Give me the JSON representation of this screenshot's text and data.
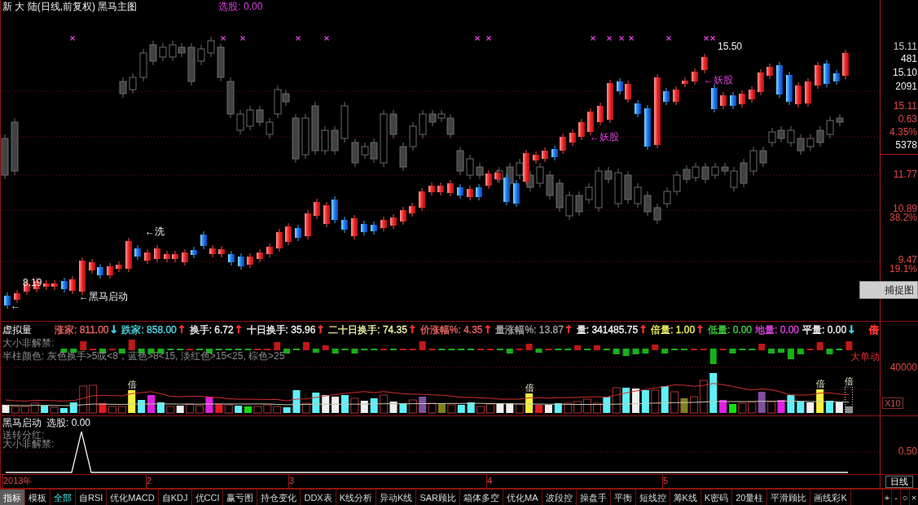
{
  "main_chart": {
    "title": "新 大 陆(日线,前复权) 黑马主图",
    "signal_readout": "选股: 0.00",
    "annotations": [
      {
        "text": "8.19",
        "kind": "note"
      },
      {
        "text": "←",
        "kind": "note"
      },
      {
        "text": "←黑马启动",
        "kind": "note"
      },
      {
        "text": "←洗",
        "kind": "note"
      },
      {
        "text": "←妖股",
        "kind": "alert"
      },
      {
        "text": "←妖股",
        "kind": "alert"
      },
      {
        "text": "15.50",
        "kind": "note"
      }
    ],
    "quote_box": [
      {
        "text": "15.11",
        "color": "#c8c8c8"
      },
      {
        "text": "481",
        "color": "#f0f0f0"
      },
      {
        "text": "15.10",
        "color": "#f0f0f0"
      },
      {
        "text": "2091",
        "color": "#f0f0f0"
      },
      {
        "text": "15.11",
        "color": "#e04848"
      },
      {
        "text": "0.63",
        "color": "#e04848"
      },
      {
        "text": "4.35%",
        "color": "#e04848"
      },
      {
        "text": "5378",
        "color": "#f0f0f0"
      }
    ],
    "axis_ticks": [
      "11.77",
      "10.89",
      "38.2%",
      "9.47",
      "19.1%"
    ],
    "capture_button": "捕捉图"
  },
  "volume_panel": {
    "title": "虚拟量",
    "readouts": [
      {
        "text": "涨家: 811.00",
        "color": "#e86464",
        "arrow": {
          "text": "↓",
          "color": "#40d8f0"
        }
      },
      {
        "text": "跌家: 858.00",
        "color": "#50d8e8",
        "arrow": {
          "text": "↑",
          "color": "#ff3030"
        }
      },
      {
        "text": "换手: 6.72",
        "color": "#f0f0f0",
        "arrow": {
          "text": "↑",
          "color": "#ff3030"
        }
      },
      {
        "text": "十日换手: 35.96",
        "color": "#f0f0f0",
        "arrow": {
          "text": "↑",
          "color": "#ff3030"
        }
      },
      {
        "text": "二十日换手: 74.35",
        "color": "#f0f0a0",
        "arrow": {
          "text": "↑",
          "color": "#ff3030"
        }
      },
      {
        "text": "价涨幅%: 4.35",
        "color": "#e86464",
        "arrow": {
          "text": "↑",
          "color": "#ff3030"
        }
      },
      {
        "text": "量涨幅%: 13.87",
        "color": "#a0a0a0",
        "arrow": {
          "text": "↑",
          "color": "#ff3030"
        }
      },
      {
        "text": "量: 341485.75",
        "color": "#f0f0f0",
        "arrow": {
          "text": "↑",
          "color": "#ff3030"
        }
      },
      {
        "text": "倍量: 1.00",
        "color": "#f0f060",
        "arrow": {
          "text": "↑",
          "color": "#ff3030"
        }
      },
      {
        "text": "低量: 0.00",
        "color": "#40d040"
      },
      {
        "text": "地量: 0.00",
        "color": "#e040e0"
      },
      {
        "text": "平量: 0.00",
        "color": "#f0f0f0",
        "arrow": {
          "text": "↓",
          "color": "#40d8f0"
        }
      },
      {
        "text": "倍",
        "color": "#ff3030"
      }
    ],
    "notes": [
      "大小非解禁:",
      "半柱颜色: 灰色换手>5或<8，蓝色>8<15, 淡红色>15<25, 棕色>25"
    ],
    "side_label": "大单动",
    "bar_marks": [
      "倍",
      "倍",
      "倍",
      "倍"
    ],
    "axis_ticks": [
      "40000"
    ],
    "scale_badge": "X10"
  },
  "signal_panel": {
    "title": "黑马启动",
    "readout": "选股: 0.00",
    "notes": [
      "送转分红:",
      "大小非解禁:"
    ],
    "axis_ticks": [
      "0.50"
    ]
  },
  "date_axis": {
    "labels": [
      "2013年",
      "2",
      "3",
      "4",
      "5"
    ],
    "period": "日线"
  },
  "bottom_bar": {
    "mode_tabs": [
      {
        "label": "指标",
        "selected": true
      },
      {
        "label": "模板",
        "selected": false
      }
    ],
    "indicator_tabs": [
      {
        "label": "全部",
        "selected": true
      },
      {
        "label": "自RSI",
        "selected": false
      },
      {
        "label": "优化MACD",
        "selected": false
      },
      {
        "label": "自KDJ",
        "selected": false
      },
      {
        "label": "优CCI",
        "selected": false
      },
      {
        "label": "赢亏图",
        "selected": false
      },
      {
        "label": "持仓变化",
        "selected": false
      },
      {
        "label": "DDX表",
        "selected": false
      },
      {
        "label": "K线分析",
        "selected": false
      },
      {
        "label": "异动K线",
        "selected": false
      },
      {
        "label": "SAR顾比",
        "selected": false
      },
      {
        "label": "箱体多空",
        "selected": false
      },
      {
        "label": "优化MA",
        "selected": false
      },
      {
        "label": "波段控",
        "selected": false
      },
      {
        "label": "操盘手",
        "selected": false
      },
      {
        "label": "平衡",
        "selected": false
      },
      {
        "label": "短线控",
        "selected": false
      },
      {
        "label": "筹K线",
        "selected": false
      },
      {
        "label": "K密码",
        "selected": false
      },
      {
        "label": "20量柱",
        "selected": false
      },
      {
        "label": "平滑顾比",
        "selected": false
      },
      {
        "label": "画线彩K",
        "selected": false
      }
    ],
    "controls": [
      "+",
      "-",
      "○",
      "×"
    ]
  }
}
